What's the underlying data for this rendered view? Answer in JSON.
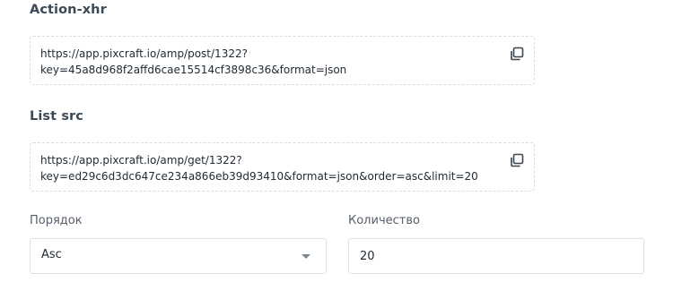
{
  "action_xhr": {
    "title": "Action-xhr",
    "url_line1": "https://app.pixcraft.io/amp/post/1322?",
    "url_line2": "key=45a8d968f2affd6cae15514cf3898c36&format=json",
    "copy_icon": "copy-icon"
  },
  "list_src": {
    "title": "List src",
    "url_line1": "https://app.pixcraft.io/amp/get/1322?",
    "url_line2": "key=ed29c6d3dc647ce234a866eb39d93410&format=json&order=asc&limit=20",
    "copy_icon": "copy-icon"
  },
  "order": {
    "label": "Порядок",
    "selected": "Asc",
    "arrow_icon": "caret-down-icon"
  },
  "quantity": {
    "label": "Количество",
    "value": "20"
  }
}
